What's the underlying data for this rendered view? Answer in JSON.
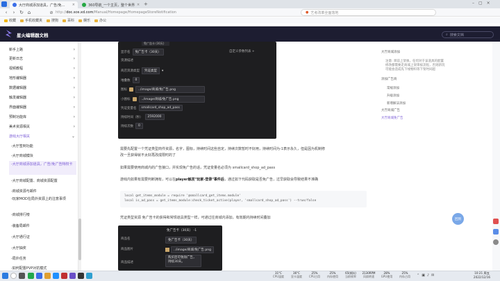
{
  "browser": {
    "tabs": [
      {
        "title": "大厅商城添加道具，广告/免…",
        "active": true,
        "color": "#3b6ee8"
      },
      {
        "title": "360导航_一个主页，整个世界",
        "active": false,
        "color": "#27a844"
      }
    ],
    "url_prefix": "http://",
    "url_domain": "doc.sce.xd.com",
    "url_path": "/Manual/Homepage/HomepageStoreNotification",
    "search_placeholder": "艺考改革全面落地",
    "bookmarks": [
      "收藏",
      "手机收藏夹",
      "搜狗",
      "百科",
      "娱乐",
      "办公"
    ]
  },
  "site": {
    "name": "星火编辑器文档",
    "search_placeholder": "搜索文档"
  },
  "sidebar": {
    "items": [
      {
        "label": "新手上路",
        "chevron": "›"
      },
      {
        "label": "更新日志",
        "chevron": "›"
      },
      {
        "label": "视频教程",
        "chevron": "›"
      },
      {
        "label": "地形编辑器",
        "chevron": "›"
      },
      {
        "label": "数据编辑器",
        "chevron": "›"
      },
      {
        "label": "触发编辑器",
        "chevron": "›"
      },
      {
        "label": "界面编辑器",
        "chevron": "›"
      },
      {
        "label": "预制功能库",
        "chevron": "›"
      },
      {
        "label": "美术资源相关",
        "chevron": "›"
      },
      {
        "label": "游戏大厅相关",
        "chevron": "⌄"
      },
      {
        "label": "-大厅签到功能",
        "chevron": ""
      },
      {
        "label": "-大厅商城模块",
        "chevron": ""
      },
      {
        "label": "-大厅商城添加道具，广告/免广告特权卡",
        "chevron": ""
      },
      {
        "label": "-大厅商城配置、商城资源配置",
        "chevron": ""
      },
      {
        "label": "-商城资源与邮件",
        "chevron": ""
      },
      {
        "label": "-玩家MOD在局外资源上的注意事项",
        "chevron": ""
      },
      {
        "label": "-商城排行榜",
        "chevron": ""
      },
      {
        "label": "-装备局邮件",
        "chevron": ""
      },
      {
        "label": "-大厅通行证",
        "chevron": ""
      },
      {
        "label": "-大厅抽奖",
        "chevron": ""
      },
      {
        "label": "-局外任务",
        "chevron": ""
      },
      {
        "label": "-如何配置PVP对抗模式",
        "chevron": ""
      }
    ]
  },
  "panel1": {
    "title": "免广告卡 (30天)",
    "rows": {
      "name_label": "显示名",
      "name_value": "免广告卡（30天）",
      "custom_label": "自定义参数列表 +",
      "type_label": "资源描述",
      "reward_label": "商店资源类型",
      "reward_value": "凭证类型",
      "count_label": "堆叠数",
      "count_value": "0",
      "icon_label": "图标",
      "icon_value": "../image/商城/免广告.png",
      "small_icon_label": "小图标",
      "small_icon_value": "../image/商城/免广告.png",
      "var_label": "凭证变量名",
      "var_value": "smallcard_shop_ad_pass",
      "duration_label": "持续时间（秒）",
      "duration_value": "2592000",
      "limit_label": "持续次数",
      "limit_value": "0"
    }
  },
  "content": {
    "p1_line1": "需要先配置一个凭证类型商件资源，名字，图标，持续时间这些自定，持续次数暂时不好用，持续时间为-1表示永久，但是因为机制修",
    "p1_line2": "改一旦获得就不太好再改成限时的了",
    "p2": "如果需要使用商城内的广告接口，并实现免广告的话，凭证变量名必须为 smallcard_shop_ad_pass",
    "p3_pre": "游戏内如果有需要判断拥有，可以在",
    "p3_bold": "player触发\"玩家-登录\"事件后",
    "p3_post": "，通过如下代码获取是否免广告，过早获取会导致结果不准确",
    "code_line1": "local get_items_module = require '@smallcard_get_items.module'",
    "code_line2": "local is_ad_pass = get_items_module:check_ticket_active(player, 'smallcard_shop_ad_pass') --true/false",
    "p4": "凭证类型资源 免广告卡的获得和常规道具类型一样，可通过往商城内添加，有效期内持续时间叠加"
  },
  "panel2": {
    "header": "免广告卡（30天） -1",
    "rows": [
      {
        "label": "商品名",
        "value": "免广告卡（30天）"
      },
      {
        "label": "商品图片",
        "value": "../image/商城/免广告.png"
      },
      {
        "label": "商品描述",
        "value": "购买后可免除广告，持续30天。"
      }
    ]
  },
  "toc": {
    "items": [
      "大厅商城添加",
      "注意: 目前上架後，任何对于该道具的配置",
      "修改都需要走商城上架审核流程，否则新玩",
      "可能会造成先下线物料等下架时间超",
      "添加广告商",
      "常规添加",
      "升级添加",
      "新增解法添加",
      "大厅商城广告",
      "大厅商城免广告"
    ]
  },
  "fab_label": "回到",
  "taskbar": {
    "stats": [
      {
        "value": "31°C",
        "label": "CPU温度"
      },
      {
        "value": "36°C",
        "label": "显卡温度"
      },
      {
        "value": "25%",
        "label": "CPU占用"
      },
      {
        "value": "25%",
        "label": "内存使用"
      },
      {
        "value": "65(帧/s)",
        "label": "当前帧率"
      },
      {
        "value": "2130RPM",
        "label": "风扇转速"
      },
      {
        "value": "28%",
        "label": "GPU使用"
      },
      {
        "value": "25%",
        "label": "内存占用"
      }
    ],
    "time": "10:21 周五",
    "date": "2022/12/16"
  }
}
